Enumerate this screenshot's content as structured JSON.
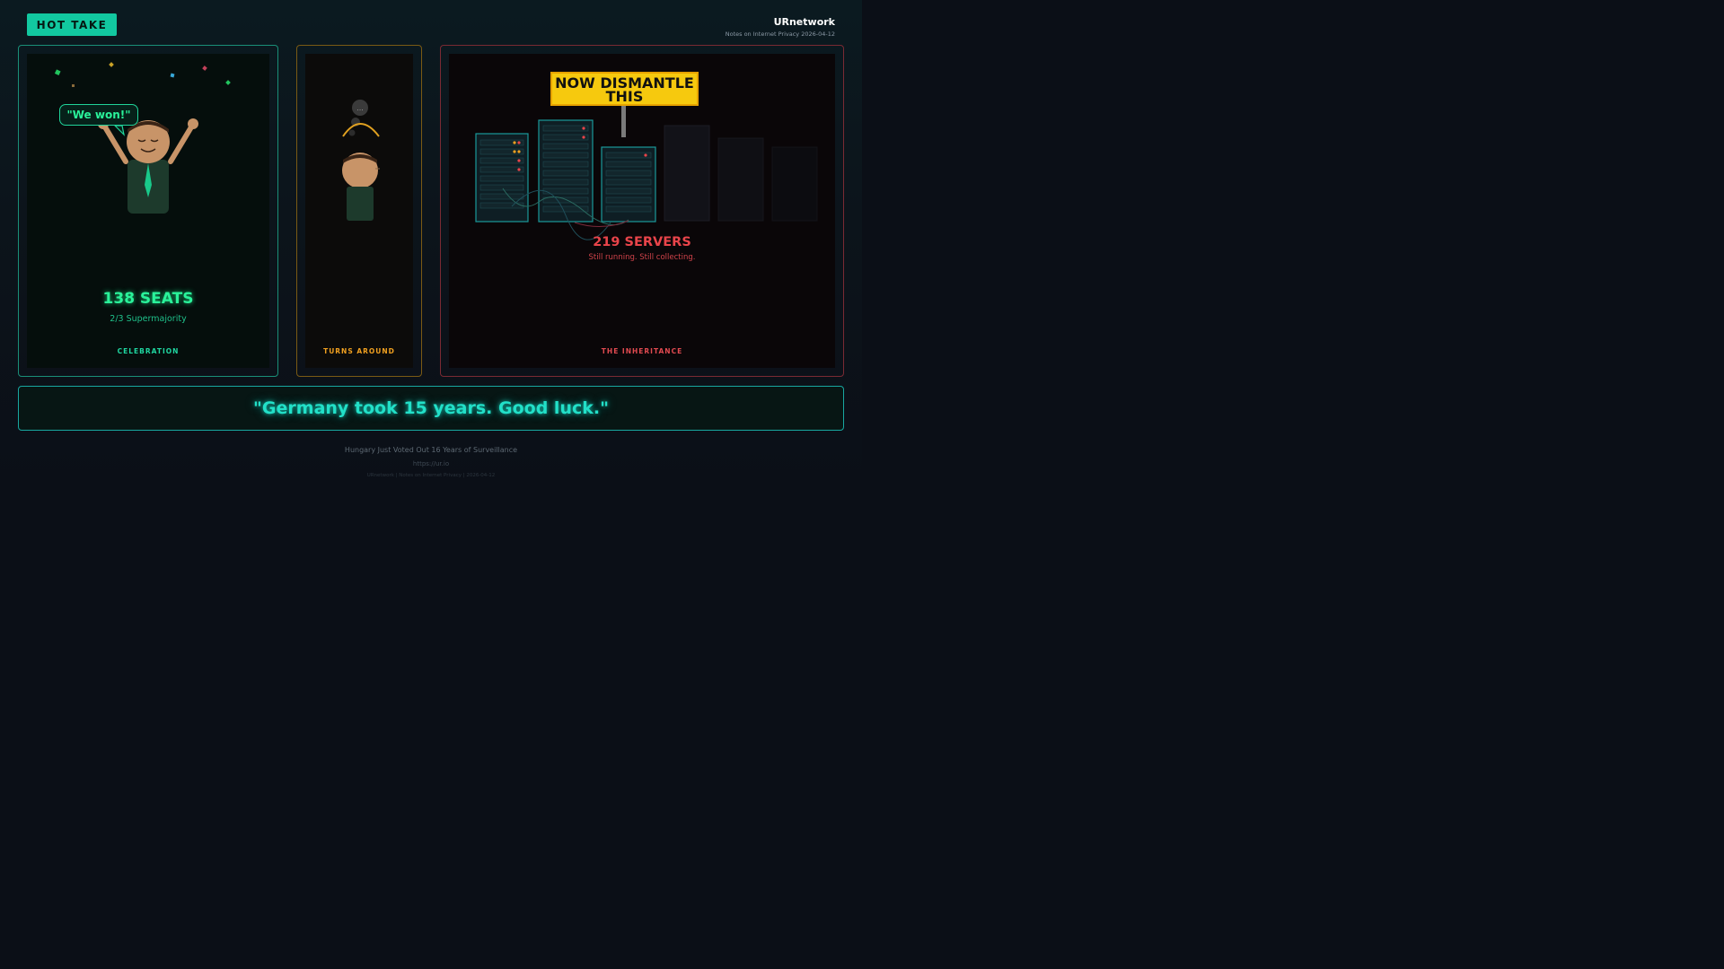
{
  "badge": "HOT TAKE",
  "brand": {
    "name": "URnetwork",
    "subtitle": "Notes on Internet Privacy 2026-04-12"
  },
  "panels": {
    "celebration": {
      "bubble": "\"We won!\"",
      "seats": "138 SEATS",
      "majority": "2/3 Supermajority",
      "caption": "CELEBRATION"
    },
    "turns_around": {
      "thought": "...",
      "caption": "TURNS AROUND"
    },
    "inheritance": {
      "sign": "NOW DISMANTLE THIS",
      "servers": "219 SERVERS",
      "servers_sub": "Still running. Still collecting.",
      "caption": "THE INHERITANCE"
    }
  },
  "quote": "\"Germany took 15 years. Good luck.\"",
  "footer": {
    "title": "Hungary Just Voted Out 16 Years of Surveillance",
    "link": "https://ur.io",
    "note": "URnetwork | Notes on Internet Privacy | 2026-04-12"
  },
  "colors": {
    "accent": "#12c8a0",
    "celebration": "#2af29a",
    "turns_around": "#f0a020",
    "inheritance": "#e9444a",
    "sign": "#f6c90e"
  }
}
